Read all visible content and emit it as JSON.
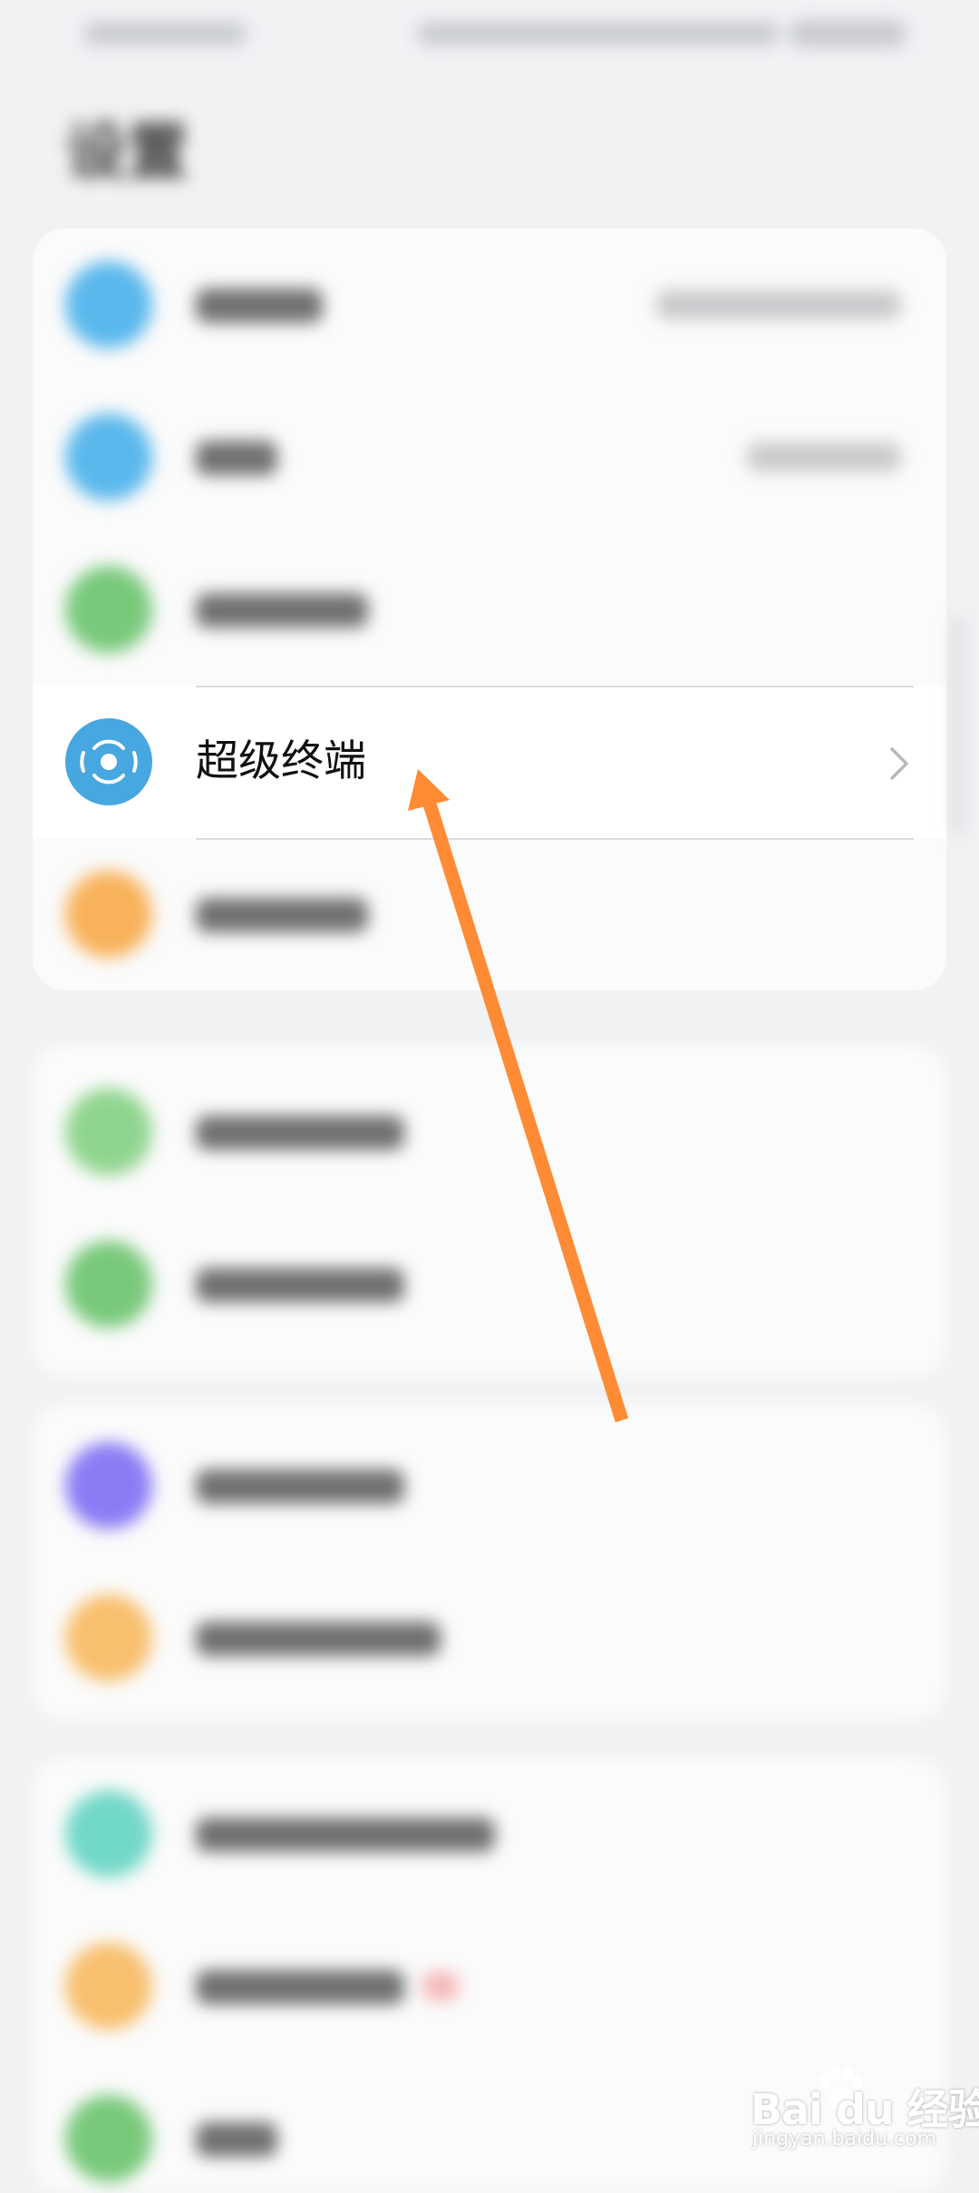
{
  "page_title": "设置",
  "highlighted_item": {
    "label": "超级终端",
    "icon": "super-device-icon",
    "icon_color": "#47a7e0"
  },
  "annotation": {
    "arrow_color": "#ff8b34"
  },
  "watermark": {
    "brand": "Bai du 经验",
    "url": "jingyan.baidu.com"
  },
  "colors": {
    "background": "#f1f2f4",
    "card": "#fbfbfb",
    "accent_blue": "#5bb8ec",
    "accent_green": "#79c97b",
    "accent_orange": "#f8b25b",
    "accent_purple": "#8b7cf5",
    "accent_teal": "#72d8c8"
  }
}
